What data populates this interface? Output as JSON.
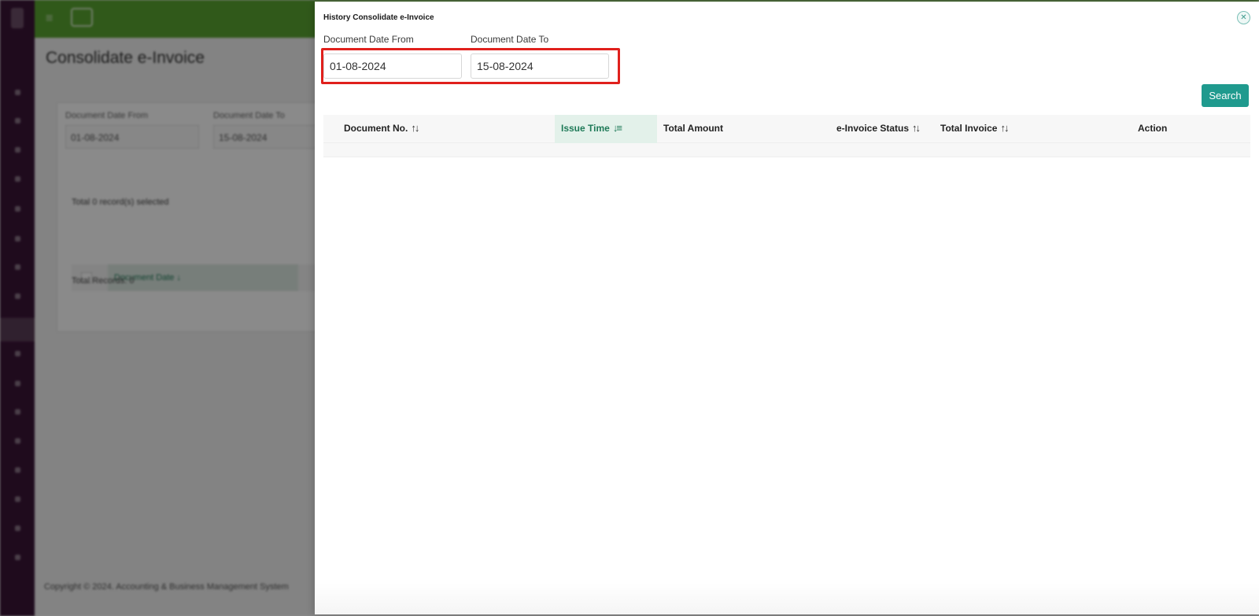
{
  "background": {
    "page_title": "Consolidate e-Invoice",
    "filter_from_label": "Document Date From",
    "filter_from_value": "01-08-2024",
    "filter_to_label": "Document Date To",
    "filter_to_value": "15-08-2024",
    "selected_text": "Total 0 record(s) selected",
    "sorted_column": "Document Date",
    "sorted_column_icon": "sort-desc-icon",
    "total_records": "Total Records: 0",
    "footer": "Copyright © 2024. Accounting & Business Management System"
  },
  "modal": {
    "title": "History Consolidate e-Invoice",
    "close_icon": "close-circle-icon",
    "from_label": "Document Date From",
    "from_value": "01-08-2024",
    "to_label": "Document Date To",
    "to_value": "15-08-2024",
    "search_label": "Search",
    "highlight_color": "#e0201c",
    "accent_color": "#1f9a8e",
    "table": {
      "columns": [
        {
          "label": "Document No.",
          "sort_icon": "sort-both-icon",
          "sort_glyph": "↑↓"
        },
        {
          "label": "Issue Time",
          "sort_icon": "sort-desc-icon",
          "sort_glyph": "↓≡",
          "sorted": true
        },
        {
          "label": "Total Amount",
          "sort_icon": "",
          "sort_glyph": ""
        },
        {
          "label": "e-Invoice Status",
          "sort_icon": "sort-both-icon",
          "sort_glyph": "↑↓"
        },
        {
          "label": "Total Invoice",
          "sort_icon": "sort-both-icon",
          "sort_glyph": "↑↓"
        },
        {
          "label": "Action",
          "sort_icon": "",
          "sort_glyph": ""
        }
      ],
      "rows": []
    }
  }
}
